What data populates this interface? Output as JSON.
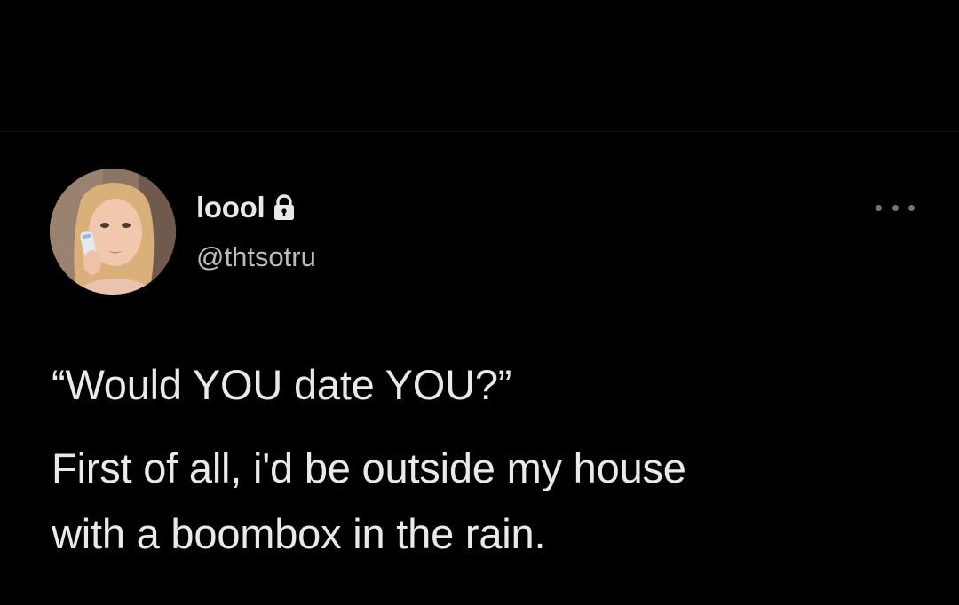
{
  "tweet": {
    "author": {
      "display_name": "loool",
      "handle": "@thtsotru",
      "protected_icon": "lock-icon",
      "avatar_icon": "avatar"
    },
    "more_icon": "more-options-icon",
    "text": {
      "quote": "“Would YOU date YOU?”",
      "line1": "First of all, i'd be outside my house",
      "line2": "with a boombox in the rain."
    }
  },
  "colors": {
    "background": "#000000",
    "text_primary": "#e7e9ea",
    "text_secondary": "#b9bcc0",
    "icon_muted": "#71767b"
  }
}
